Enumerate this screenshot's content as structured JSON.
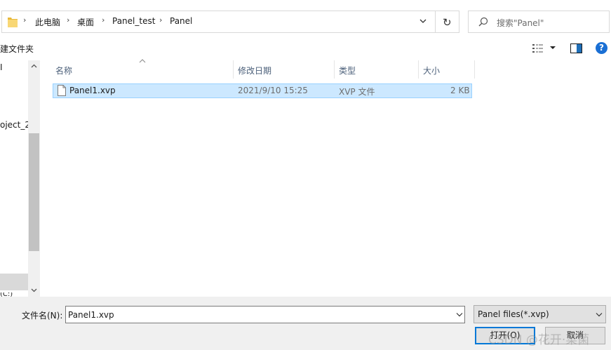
{
  "address_bar": {
    "breadcrumbs": [
      "此电脑",
      "桌面",
      "Panel_test",
      "Panel"
    ]
  },
  "search": {
    "placeholder": "搜索\"Panel\""
  },
  "toolbar": {
    "new_folder_label": "建文件夹"
  },
  "nav_pane": {
    "items": [
      "I",
      "oject_2",
      "(C:)"
    ]
  },
  "file_list": {
    "columns": [
      "名称",
      "修改日期",
      "类型",
      "大小"
    ],
    "rows": [
      {
        "name": "Panel1.xvp",
        "modified": "2021/9/10 15:25",
        "type": "XVP 文件",
        "size": "2 KB"
      }
    ]
  },
  "bottom": {
    "filename_label": "文件名(N):",
    "filename_value": "Panel1.xvp",
    "filetype_value": "Panel files(*.xvp)",
    "open_label": "打开(O)",
    "cancel_label": "取消"
  },
  "watermark": "CSDN @花开·菜菌",
  "colors": {
    "selection_bg": "#cce8ff",
    "selection_border": "#99d1ff",
    "accent": "#0078d7",
    "help_icon": "#1a6fd4"
  }
}
